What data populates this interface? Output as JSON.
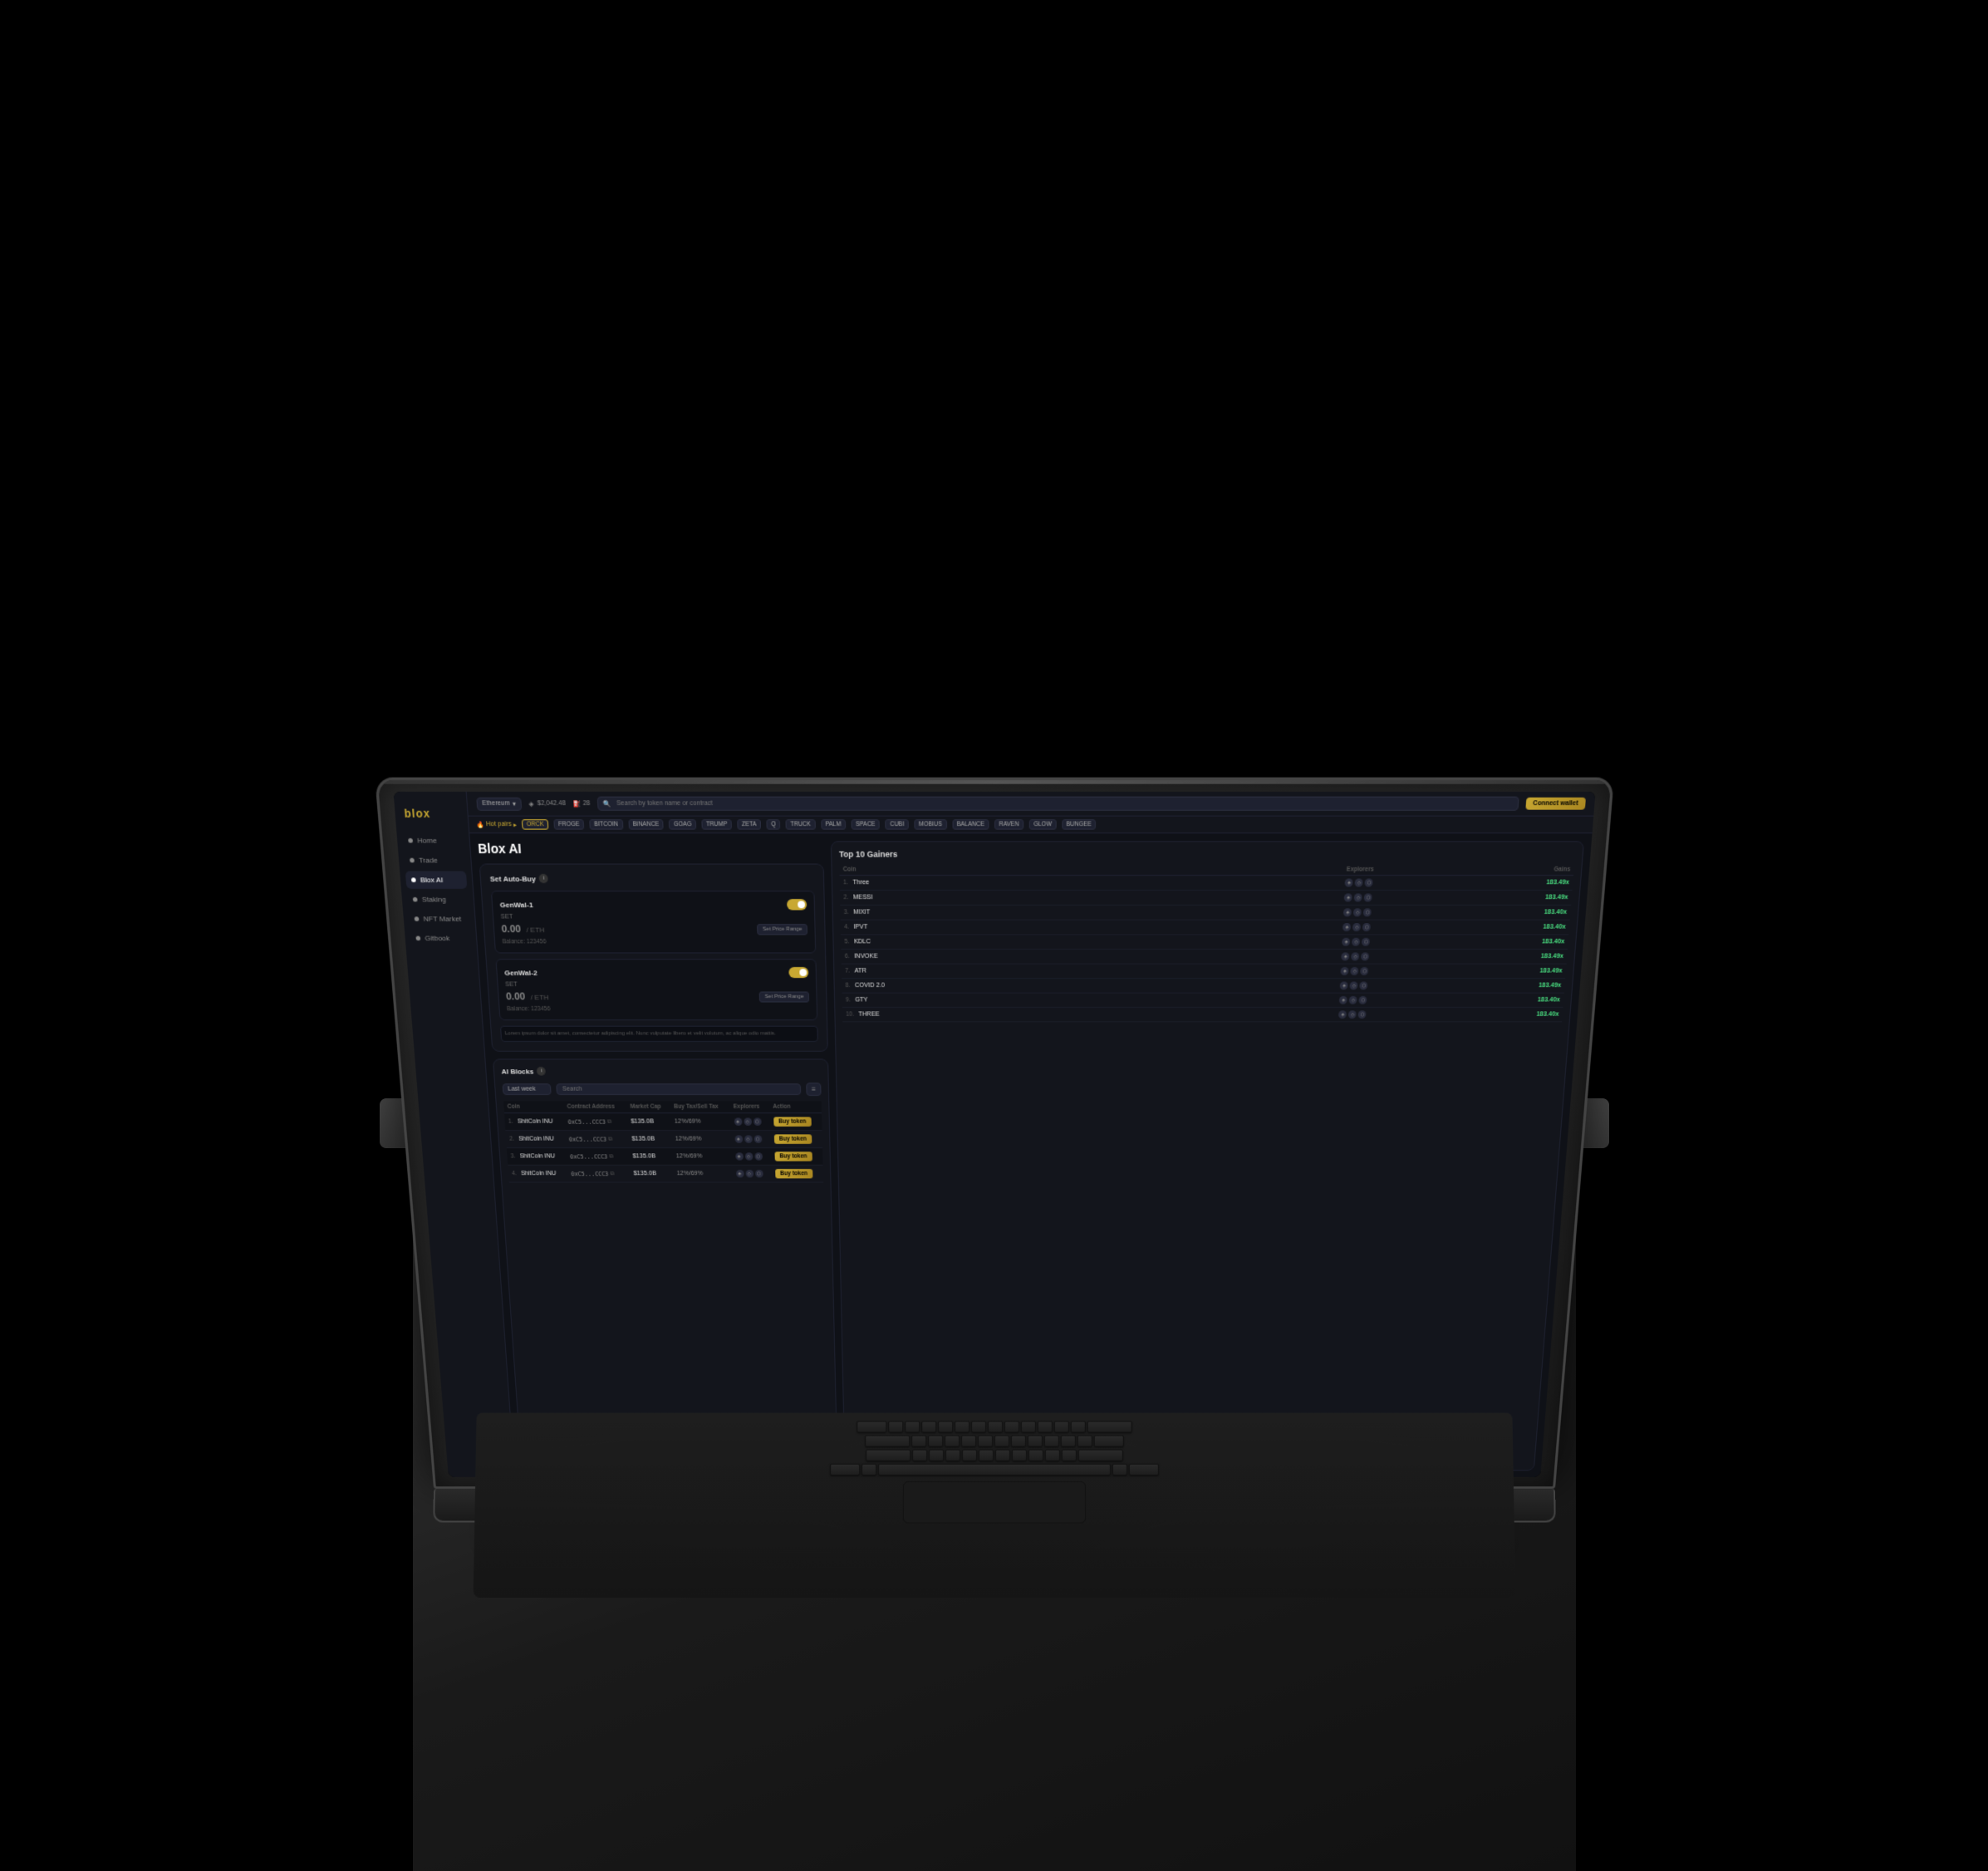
{
  "app": {
    "logo": "blox",
    "network": "Ethereum",
    "price": "$2,042.48",
    "gas": "28",
    "search_placeholder": "Search by token name or contract",
    "connect_btn": "Connect wallet"
  },
  "sidebar": {
    "items": [
      {
        "label": "Home",
        "id": "home"
      },
      {
        "label": "Trade",
        "id": "trade"
      },
      {
        "label": "Blox AI",
        "id": "blox-ai",
        "active": true
      },
      {
        "label": "Staking",
        "id": "staking"
      },
      {
        "label": "NFT Market",
        "id": "nft-market"
      },
      {
        "label": "Gitbook",
        "id": "gitbook"
      }
    ]
  },
  "hotpairs": {
    "label": "Hot pairs",
    "pairs": [
      "ORCK",
      "FROGE",
      "BITCOIN",
      "BINANCE",
      "GOAG",
      "TRUMP",
      "ZETA",
      "Q",
      "TRUCK",
      "PALM",
      "SPACE",
      "CUBI",
      "MOBIUS",
      "BALANCE",
      "RAVEN",
      "GLOW",
      "BUNGEE"
    ]
  },
  "page": {
    "title": "Blox AI"
  },
  "autobuy": {
    "section_title": "Set Auto-Buy",
    "wallets": [
      {
        "name": "GenWal-1",
        "status": "SET",
        "amount": "0.00",
        "unit": "/ ETH",
        "balance_label": "Balance:",
        "balance": "123456",
        "btn": "Set Price Range",
        "toggle": true
      },
      {
        "name": "GenWal-2",
        "status": "SET",
        "amount": "0.00",
        "unit": "/ ETH",
        "balance_label": "Balance:",
        "balance": "123456",
        "btn": "Set Price Range",
        "toggle": true
      }
    ],
    "disclaimer": "Lorem ipsum dolor sit amet, consectetur adipiscing elit. Nunc vulputate libero et velit volutum, ac alique odio mattis."
  },
  "aiblocks": {
    "section_title": "AI Blocks",
    "filter_default": "Last week",
    "search_placeholder": "Search",
    "columns": [
      "Coin",
      "Contract Address",
      "Market Cap",
      "Buy Tax/Sell Tax",
      "Explorers",
      "Action"
    ],
    "rows": [
      {
        "num": "1.",
        "coin": "ShitCoin INU",
        "contract": "0xC5...CCC3",
        "market_cap": "$135.0B",
        "tax": "12%/69%",
        "buy_label": "Buy token"
      },
      {
        "num": "2.",
        "coin": "ShitCoin INU",
        "contract": "0xC5...CCC3",
        "market_cap": "$135.0B",
        "tax": "12%/69%",
        "buy_label": "Buy token"
      },
      {
        "num": "3.",
        "coin": "ShitCoin INU",
        "contract": "0xC5...CCC3",
        "market_cap": "$135.0B",
        "tax": "12%/69%",
        "buy_label": "Buy token"
      },
      {
        "num": "4.",
        "coin": "ShitCoin INU",
        "contract": "0xC5...CCC3",
        "market_cap": "$135.0B",
        "tax": "12%/69%",
        "buy_label": "Buy token"
      }
    ]
  },
  "gainers": {
    "title": "Top 10 Gainers",
    "columns": {
      "coin": "Coin",
      "explorers": "Explorers",
      "gains": "Gains"
    },
    "rows": [
      {
        "num": "1.",
        "name": "Three",
        "gain": "183.49x"
      },
      {
        "num": "2.",
        "name": "MESSI",
        "gain": "183.49x"
      },
      {
        "num": "3.",
        "name": "MIXIT",
        "gain": "183.40x"
      },
      {
        "num": "4.",
        "name": "IPVT",
        "gain": "183.40x"
      },
      {
        "num": "5.",
        "name": "KDLC",
        "gain": "183.40x"
      },
      {
        "num": "6.",
        "name": "INVOKE",
        "gain": "183.49x"
      },
      {
        "num": "7.",
        "name": "ATR",
        "gain": "183.49x"
      },
      {
        "num": "8.",
        "name": "COVID 2.0",
        "gain": "183.49x"
      },
      {
        "num": "9.",
        "name": "GTY",
        "gain": "183.40x"
      },
      {
        "num": "10.",
        "name": "THREE",
        "gain": "183.40x"
      }
    ]
  },
  "colors": {
    "accent": "#c8a832",
    "bg_dark": "#0f1117",
    "bg_card": "#13151c",
    "bg_hover": "#1e2130",
    "border": "#1e2130",
    "green": "#4ade80",
    "text_dim": "#666",
    "text_mid": "#888"
  }
}
